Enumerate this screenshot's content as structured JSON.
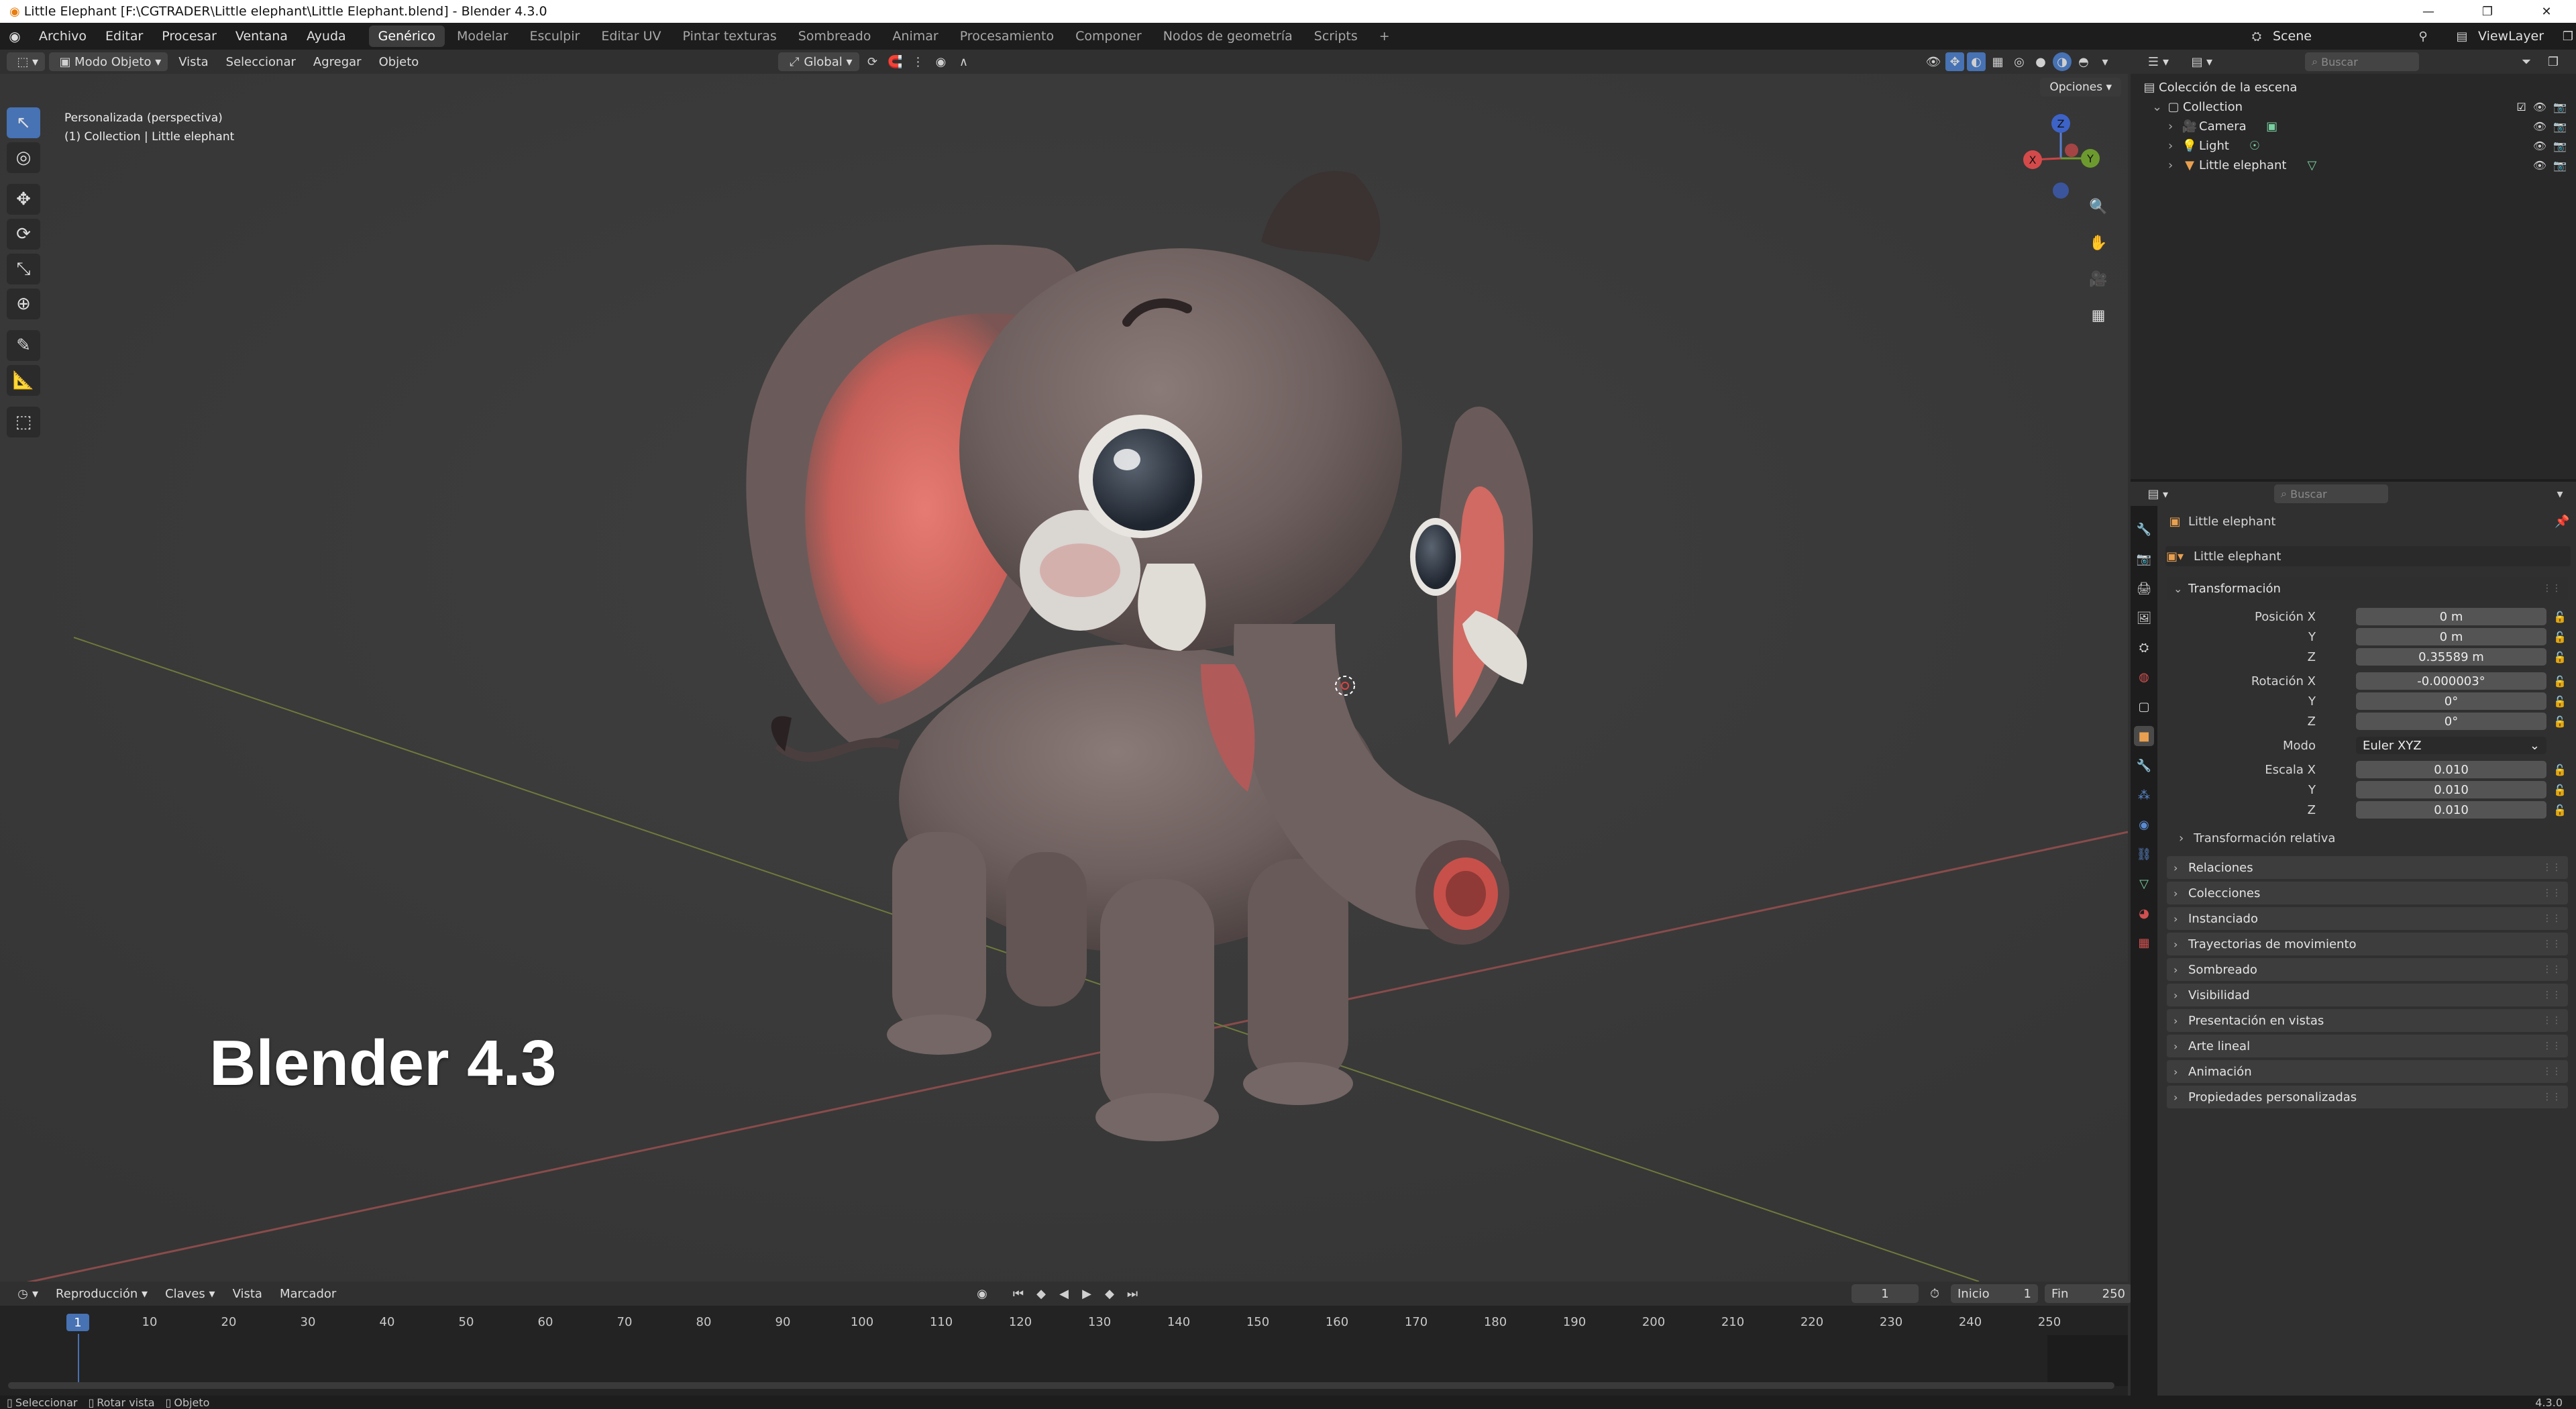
{
  "window": {
    "title": "Little Elephant [F:\\CGTRADER\\Little elephant\\Little Elephant.blend] - Blender 4.3.0",
    "controls": [
      "—",
      "❐",
      "✕"
    ]
  },
  "menubar": {
    "menus": [
      "Archivo",
      "Editar",
      "Procesar",
      "Ventana",
      "Ayuda"
    ],
    "workspaces": [
      "Genérico",
      "Modelar",
      "Esculpir",
      "Editar UV",
      "Pintar texturas",
      "Sombreado",
      "Animar",
      "Procesamiento",
      "Componer",
      "Nodos de geometría",
      "Scripts"
    ],
    "active_workspace": "Genérico",
    "add_tab": "+",
    "scene": "Scene",
    "view_layer": "ViewLayer"
  },
  "viewport_header": {
    "mode": "Modo Objeto",
    "menus": [
      "Vista",
      "Seleccionar",
      "Agregar",
      "Objeto"
    ],
    "orientation": "Global",
    "options": "Opciones"
  },
  "viewport": {
    "view_name": "Personalizada (perspectiva)",
    "collection_info": "(1) Collection | Little elephant",
    "watermark": "Blender 4.3",
    "gizmo": {
      "z": "Z",
      "x": "X",
      "y": "Y"
    }
  },
  "timeline": {
    "menus": [
      "Reproducción",
      "Claves",
      "Vista",
      "Marcador"
    ],
    "current_frame": "1",
    "start_label": "Inicio",
    "start": "1",
    "end_label": "Fin",
    "end": "250",
    "ruler": [
      "10",
      "20",
      "30",
      "40",
      "50",
      "60",
      "70",
      "80",
      "90",
      "100",
      "110",
      "120",
      "130",
      "140",
      "150",
      "160",
      "170",
      "180",
      "190",
      "200",
      "210",
      "220",
      "230",
      "240",
      "250"
    ],
    "ruler_current": "1"
  },
  "statusbar": {
    "items": [
      "Seleccionar",
      "Rotar vista",
      "Objeto"
    ],
    "version": "4.3.0"
  },
  "outliner": {
    "search_placeholder": "Buscar",
    "root": "Colección de la escena",
    "collection": "Collection",
    "items": [
      "Camera",
      "Light",
      "Little elephant"
    ]
  },
  "properties": {
    "search_placeholder": "Buscar",
    "object_name": "Little elephant",
    "datablock_name": "Little elephant",
    "transform_panel": "Transformación",
    "location_label": "Posición X",
    "location": [
      "0 m",
      "0 m",
      "0.35589 m"
    ],
    "rotation_label": "Rotación X",
    "rotation": [
      "-0.000003°",
      "0°",
      "0°"
    ],
    "axis_y": "Y",
    "axis_z": "Z",
    "mode_label": "Modo",
    "mode_value": "Euler XYZ",
    "scale_label": "Escala X",
    "scale": [
      "0.010",
      "0.010",
      "0.010"
    ],
    "delta_transform": "Transformación relativa",
    "panels": [
      "Relaciones",
      "Colecciones",
      "Instanciado",
      "Trayectorias de movimiento",
      "Sombreado",
      "Visibilidad",
      "Presentación en vistas",
      "Arte lineal",
      "Animación",
      "Propiedades personalizadas"
    ]
  }
}
